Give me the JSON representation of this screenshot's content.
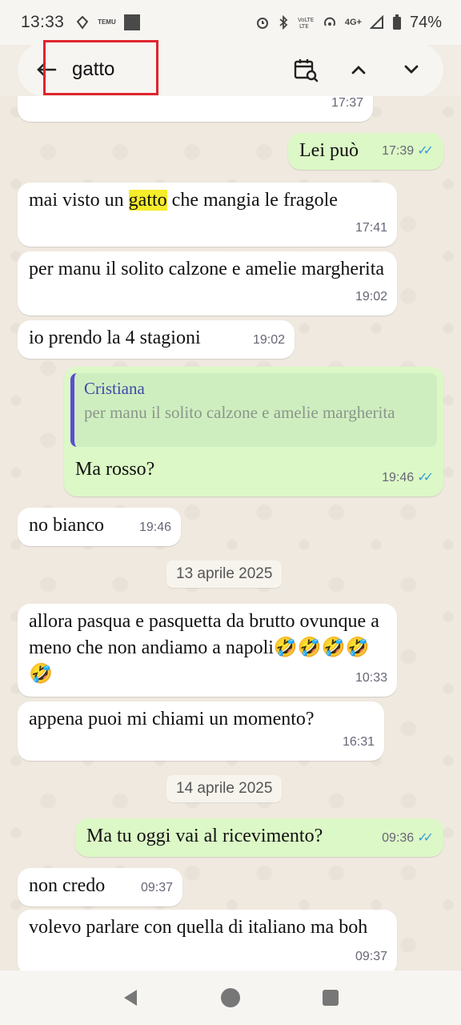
{
  "status_bar": {
    "time": "13:33",
    "left_tag": "TEMU",
    "network": "4G+",
    "battery": "74%",
    "icons": [
      "alarm-icon",
      "bluetooth-icon",
      "volte-icon",
      "hotspot-icon",
      "signal-icon",
      "battery-icon"
    ]
  },
  "search": {
    "query": "gatto",
    "back_icon": "arrow-left-icon",
    "calendar_icon": "calendar-search-icon",
    "up_icon": "chevron-up-icon",
    "down_icon": "chevron-down-icon"
  },
  "messages": {
    "m0": {
      "time": "17:37"
    },
    "m1": {
      "text": "Lei può",
      "time": "17:39"
    },
    "m2": {
      "before": "mai visto un ",
      "highlight": "gatto",
      "after": " che mangia le fragole",
      "time": "17:41"
    },
    "m3": {
      "text": "per manu il solito calzone e amelie margherita",
      "time": "19:02"
    },
    "m4": {
      "text": "io prendo la 4 stagioni",
      "time": "19:02"
    },
    "m5": {
      "quote_author": "Cristiana",
      "quote_text": "per manu il solito calzone e amelie margherita",
      "text": "Ma rosso?",
      "time": "19:46"
    },
    "m6": {
      "text": "no bianco",
      "time": "19:46"
    },
    "date1": "13 aprile 2025",
    "m7": {
      "text": "allora pasqua e pasquetta da brutto ovunque a meno che non andiamo a napoli🤣🤣🤣🤣🤣",
      "time": "10:33"
    },
    "m8": {
      "text": "appena puoi mi chiami un momento?",
      "time": "16:31"
    },
    "date2": "14 aprile 2025",
    "m9": {
      "text": "Ma tu oggi vai al ricevimento?",
      "time": "09:36"
    },
    "m10": {
      "text": "non credo",
      "time": "09:37"
    },
    "m11": {
      "text": "volevo parlare con quella di italiano ma boh",
      "time": "09:37"
    },
    "tick_icon": "double-check-icon"
  },
  "nav": {
    "back": "back-triangle-icon",
    "home": "home-circle-icon",
    "recents": "recents-square-icon"
  },
  "colors": {
    "incoming": "#ffffff",
    "outgoing": "#dcf8c6",
    "highlight": "#f5ec2a",
    "ticks": "#3a9bd9",
    "annotation_box": "#e0242c"
  }
}
